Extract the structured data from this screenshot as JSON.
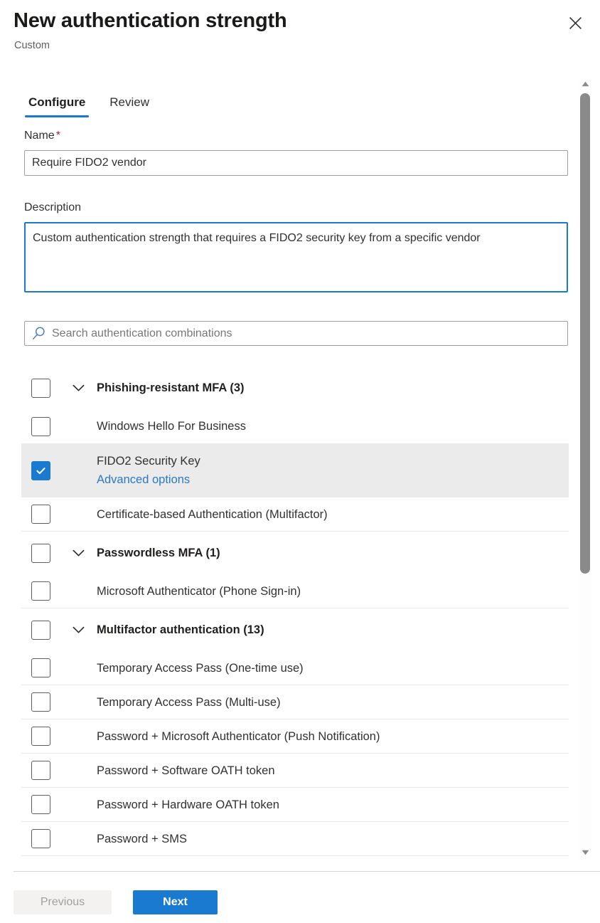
{
  "header": {
    "title": "New authentication strength",
    "subtitle": "Custom",
    "close_icon": "close-icon"
  },
  "tabs": [
    {
      "label": "Configure",
      "active": true
    },
    {
      "label": "Review",
      "active": false
    }
  ],
  "form": {
    "name_label": "Name",
    "name_required_marker": "*",
    "name_value": "Require FIDO2 vendor",
    "name_placeholder": "",
    "description_label": "Description",
    "description_value": "Custom authentication strength that requires a FIDO2 security key from a specific vendor",
    "description_placeholder": ""
  },
  "search": {
    "icon": "search-icon",
    "value": "",
    "placeholder": "Search authentication combinations"
  },
  "list": {
    "rows": [
      {
        "type": "group",
        "label": "Phishing-resistant MFA (3)",
        "checked": false,
        "chevron": "chevron-down-icon",
        "selected": false,
        "separator": false
      },
      {
        "type": "item",
        "label": "Windows Hello For Business",
        "checked": false,
        "chevron": null,
        "selected": false,
        "separator": false
      },
      {
        "type": "item",
        "label": "FIDO2 Security Key",
        "checked": true,
        "chevron": null,
        "selected": true,
        "separator": false,
        "sublink": "Advanced options"
      },
      {
        "type": "item",
        "label": "Certificate-based Authentication (Multifactor)",
        "checked": false,
        "chevron": null,
        "selected": false,
        "separator": true
      },
      {
        "type": "group",
        "label": "Passwordless MFA (1)",
        "checked": false,
        "chevron": "chevron-down-icon",
        "selected": false,
        "separator": false
      },
      {
        "type": "item",
        "label": "Microsoft Authenticator (Phone Sign-in)",
        "checked": false,
        "chevron": null,
        "selected": false,
        "separator": true
      },
      {
        "type": "group",
        "label": "Multifactor authentication (13)",
        "checked": false,
        "chevron": "chevron-down-icon",
        "selected": false,
        "separator": false
      },
      {
        "type": "item",
        "label": "Temporary Access Pass (One-time use)",
        "checked": false,
        "chevron": null,
        "selected": false,
        "separator": true
      },
      {
        "type": "item",
        "label": "Temporary Access Pass (Multi-use)",
        "checked": false,
        "chevron": null,
        "selected": false,
        "separator": true
      },
      {
        "type": "item",
        "label": "Password + Microsoft Authenticator (Push Notification)",
        "checked": false,
        "chevron": null,
        "selected": false,
        "separator": true
      },
      {
        "type": "item",
        "label": "Password + Software OATH token",
        "checked": false,
        "chevron": null,
        "selected": false,
        "separator": true
      },
      {
        "type": "item",
        "label": "Password + Hardware OATH token",
        "checked": false,
        "chevron": null,
        "selected": false,
        "separator": true
      },
      {
        "type": "item",
        "label": "Password + SMS",
        "checked": false,
        "chevron": null,
        "selected": false,
        "separator": true
      }
    ]
  },
  "scrollbar": {
    "up_arrow_icon": "scroll-up-arrow-icon",
    "down_arrow_icon": "scroll-down-arrow-icon"
  },
  "footer": {
    "previous_label": "Previous",
    "next_label": "Next"
  },
  "colors": {
    "accent": "#1a7ad0",
    "required_star": "#a4262c",
    "link": "#2b79c2",
    "selected_row_bg": "#ebebeb",
    "disabled_button_bg": "#f3f2f1",
    "disabled_button_text": "#a19f9d"
  }
}
